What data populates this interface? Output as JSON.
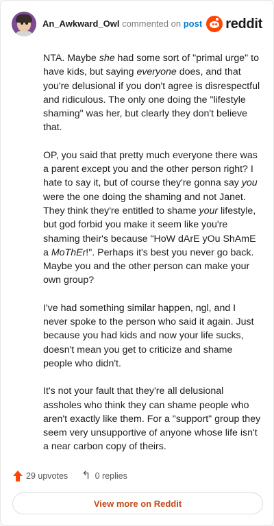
{
  "header": {
    "username": "An_Awkward_Owl",
    "verb": "commented on",
    "post_link": "post",
    "brand_word": "reddit"
  },
  "comment": {
    "paragraphs": [
      [
        {
          "t": "NTA. Maybe ",
          "i": false
        },
        {
          "t": "she",
          "i": true
        },
        {
          "t": " had some sort of \"primal urge\" to have kids, but saying ",
          "i": false
        },
        {
          "t": "everyone",
          "i": true
        },
        {
          "t": " does, and that you're delusional if you don't agree is disrespectful and ridiculous. The only one doing the \"lifestyle shaming\" was her, but clearly they don't believe that.",
          "i": false
        }
      ],
      [
        {
          "t": "OP, you said that pretty much everyone there was a parent except you and the other person right? I hate to say it, but of course they're gonna say ",
          "i": false
        },
        {
          "t": "you",
          "i": true
        },
        {
          "t": " were the one doing the shaming and not Janet. They think they're entitled to shame ",
          "i": false
        },
        {
          "t": "your",
          "i": true
        },
        {
          "t": " lifestyle, but god forbid you make it seem like you're shaming their's because \"HoW dArE yOu ShAmE a ",
          "i": false
        },
        {
          "t": "MoThEr",
          "i": true
        },
        {
          "t": "!\". Perhaps it's best you never go back. Maybe you and the other person can make your own group?",
          "i": false
        }
      ],
      [
        {
          "t": "I've had something similar happen, ngl, and I never spoke to the person who said it again. Just because you had kids and now your life sucks, doesn't mean you get to criticize and shame people who didn't.",
          "i": false
        }
      ],
      [
        {
          "t": "It's not your fault that they're all delusional assholes who think they can shame people who aren't exactly like them. For a \"support\" group they seem very unsupportive of anyone whose life isn't a near carbon copy of theirs.",
          "i": false
        }
      ]
    ]
  },
  "footer": {
    "upvotes_label": "29 upvotes",
    "replies_label": "0 replies"
  },
  "view_more_label": "View more on Reddit",
  "colors": {
    "accent": "#ff4500",
    "link": "#0079d3",
    "view_more_text": "#c04a1a"
  },
  "icons": {
    "avatar": "user-avatar",
    "brand": "reddit-snoo-icon",
    "upvote": "upvote-arrow-icon",
    "reply": "reply-arrow-icon"
  }
}
